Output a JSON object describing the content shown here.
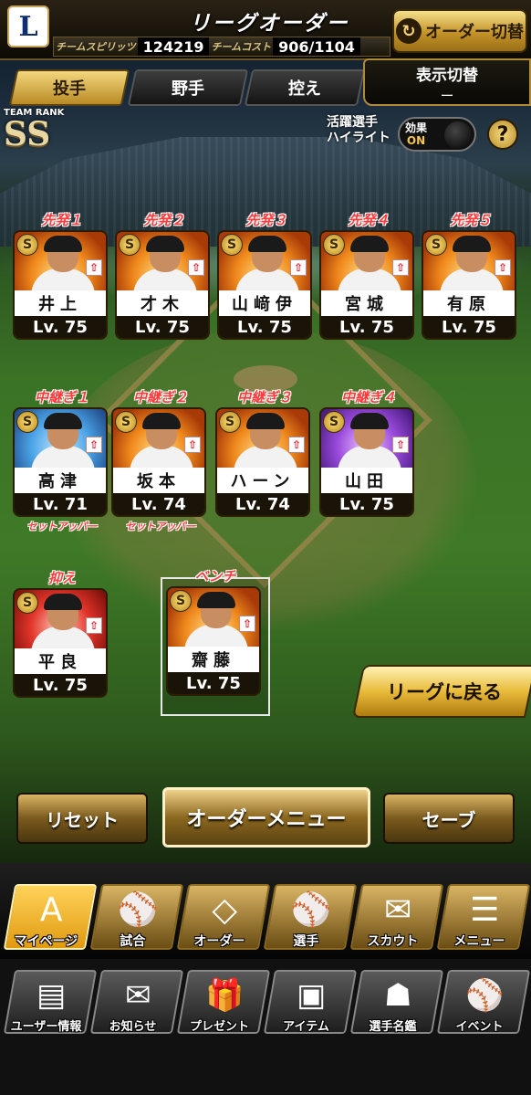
{
  "header": {
    "title": "リーグオーダー",
    "logo_letter": "L",
    "team_spirit_label": "チームスピリッツ",
    "team_spirit_value": "124219",
    "team_cost_label": "チームコスト",
    "team_cost_value": "906/1104",
    "order_switch_label": "オーダー切替",
    "order_switch_icon": "refresh-icon"
  },
  "tabs": [
    {
      "label": "投手",
      "active": true
    },
    {
      "label": "野手",
      "active": false
    },
    {
      "label": "控え",
      "active": false
    }
  ],
  "display_switch": {
    "label": "表示切替",
    "value": "ー"
  },
  "team_rank": {
    "label": "TEAM RANK",
    "value": "SS"
  },
  "highlight": {
    "label_line1": "活躍選手",
    "label_line2": "ハイライト",
    "toggle_effect": "効果",
    "toggle_state": "ON"
  },
  "help_icon": "?",
  "starters": [
    {
      "role": "先発１",
      "name": "井上",
      "level": "Lv. 75",
      "badge": "S",
      "frame": "fire"
    },
    {
      "role": "先発２",
      "name": "才木",
      "level": "Lv. 75",
      "badge": "S",
      "frame": "fire"
    },
    {
      "role": "先発３",
      "name": "山﨑伊",
      "level": "Lv. 75",
      "badge": "S",
      "frame": "fire"
    },
    {
      "role": "先発４",
      "name": "宮城",
      "level": "Lv. 75",
      "badge": "S",
      "frame": "fire"
    },
    {
      "role": "先発５",
      "name": "有原",
      "level": "Lv. 75",
      "badge": "S",
      "frame": "fire"
    }
  ],
  "relievers": [
    {
      "role": "中継ぎ１",
      "name": "高津",
      "level": "Lv. 71",
      "badge": "S",
      "sub": "セットアッパー",
      "frame": "blue"
    },
    {
      "role": "中継ぎ２",
      "name": "坂本",
      "level": "Lv. 74",
      "badge": "S",
      "sub": "セットアッパー",
      "frame": "fire"
    },
    {
      "role": "中継ぎ３",
      "name": "ハーン",
      "level": "Lv. 74",
      "badge": "S",
      "sub": "",
      "frame": "fire"
    },
    {
      "role": "中継ぎ４",
      "name": "山田",
      "level": "Lv. 75",
      "badge": "S",
      "sub": "",
      "frame": "purple"
    }
  ],
  "closer": {
    "role": "抑え",
    "name": "平良",
    "level": "Lv. 75",
    "badge": "S",
    "frame": "red"
  },
  "bench": {
    "role": "ベンチ",
    "name": "齋藤",
    "level": "Lv. 75",
    "badge": "S",
    "frame": "fire"
  },
  "back_to_league": "リーグに戻る",
  "actions": {
    "reset": "リセット",
    "order_menu": "オーダーメニュー",
    "save": "セーブ"
  },
  "nav_main": [
    {
      "label": "マイページ",
      "icon": "mypage-icon",
      "glyph": "A",
      "active": true
    },
    {
      "label": "試合",
      "icon": "stadium-icon",
      "glyph": "⚾",
      "active": false
    },
    {
      "label": "オーダー",
      "icon": "field-icon",
      "glyph": "◇",
      "active": false
    },
    {
      "label": "選手",
      "icon": "player-icon",
      "glyph": "⚾",
      "active": false
    },
    {
      "label": "スカウト",
      "icon": "scout-icon",
      "glyph": "✉",
      "active": false
    },
    {
      "label": "メニュー",
      "icon": "menu-icon",
      "glyph": "☰",
      "active": false
    }
  ],
  "nav_sub": [
    {
      "label": "ユーザー情報",
      "icon": "user-card-icon",
      "glyph": "▤"
    },
    {
      "label": "お知らせ",
      "icon": "notice-icon",
      "glyph": "✉"
    },
    {
      "label": "プレゼント",
      "icon": "gift-icon",
      "glyph": "🎁"
    },
    {
      "label": "アイテム",
      "icon": "item-icon",
      "glyph": "▣"
    },
    {
      "label": "選手名鑑",
      "icon": "player-book-icon",
      "glyph": "☗"
    },
    {
      "label": "イベント",
      "icon": "event-icon",
      "glyph": "⚾"
    }
  ]
}
